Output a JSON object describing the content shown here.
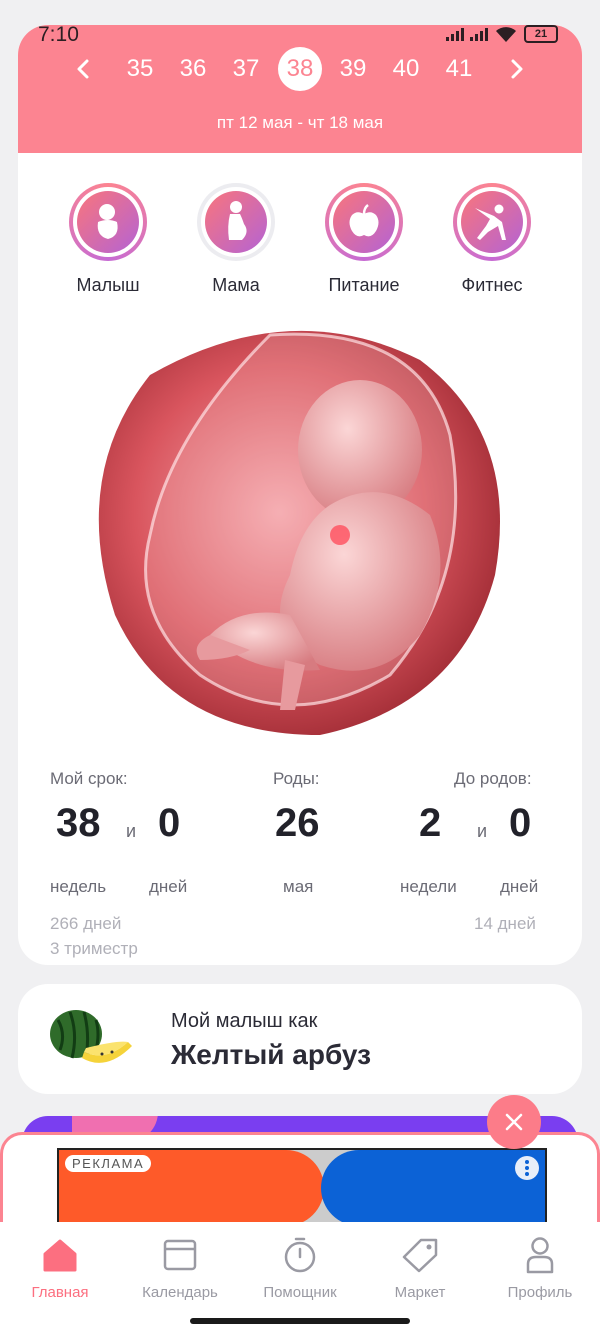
{
  "status": {
    "time": "7:10",
    "battery": "21"
  },
  "weeks": {
    "items": [
      "35",
      "36",
      "37",
      "38",
      "39",
      "40",
      "41"
    ],
    "active": "38",
    "range": "пт 12 мая - чт 18 мая"
  },
  "categories": [
    {
      "label": "Малыш",
      "icon": "baby-icon"
    },
    {
      "label": "Мама",
      "icon": "pregnant-mother-icon"
    },
    {
      "label": "Питание",
      "icon": "apple-icon"
    },
    {
      "label": "Фитнес",
      "icon": "yoga-pose-icon"
    }
  ],
  "stats": {
    "term": {
      "label": "Мой срок:",
      "weeks_value": "38",
      "weeks_unit": "недель",
      "and": "и",
      "days_value": "0",
      "days_unit": "дней",
      "total_days": "266 дней",
      "trimester": "3 триместр"
    },
    "birth": {
      "label": "Роды:",
      "day": "26",
      "month": "мая"
    },
    "remaining": {
      "label": "До родов:",
      "weeks_value": "2",
      "weeks_unit": "недели",
      "and": "и",
      "days_value": "0",
      "days_unit": "дней",
      "total_days": "14 дней"
    }
  },
  "fruit": {
    "subtitle": "Мой малыш как",
    "name": "Желтый арбуз"
  },
  "ad": {
    "tag": "РЕКЛАМА"
  },
  "tabs": [
    {
      "label": "Главная",
      "icon": "home-icon",
      "active": true
    },
    {
      "label": "Календарь",
      "icon": "calendar-icon",
      "active": false
    },
    {
      "label": "Помощник",
      "icon": "timer-icon",
      "active": false
    },
    {
      "label": "Маркет",
      "icon": "tag-icon",
      "active": false
    },
    {
      "label": "Профиль",
      "icon": "profile-icon",
      "active": false
    }
  ],
  "colors": {
    "accent": "#fc8491",
    "active_tab": "#fc6f80",
    "promo": "#7a3ef0"
  }
}
